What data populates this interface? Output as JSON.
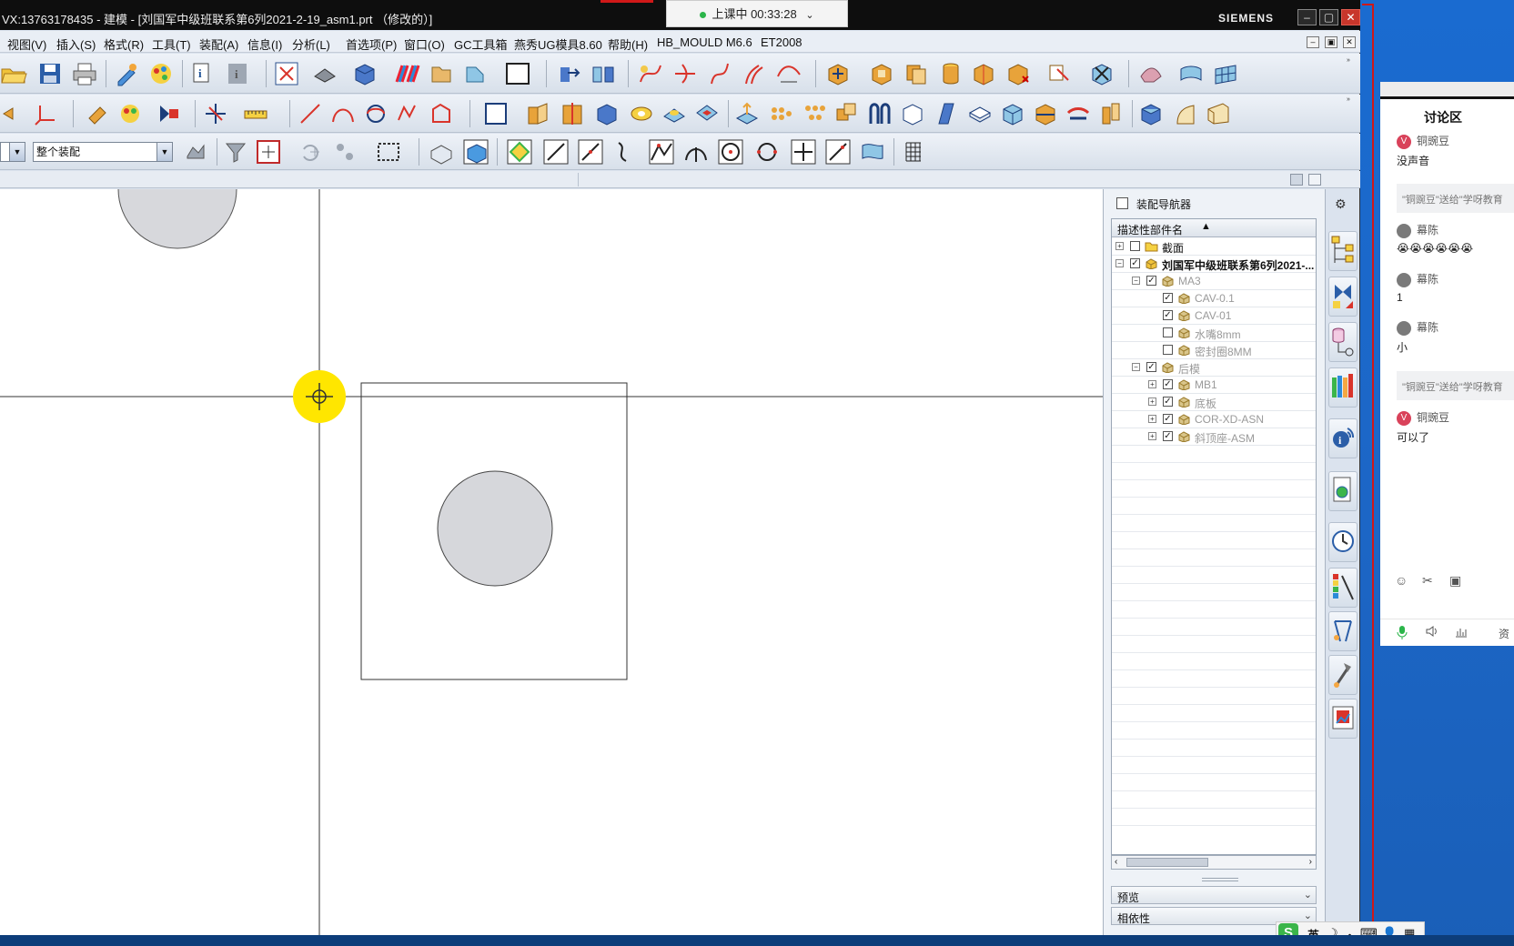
{
  "window": {
    "title": "VX:13763178435 - 建模 - [刘国军中级班联系第6列2021-2-19_asm1.prt （修改的）]",
    "brand": "SIEMENS",
    "controls": [
      "–",
      "▢",
      "✕"
    ]
  },
  "class_status": {
    "label": "上课中 00:33:28",
    "chevron": "⌄"
  },
  "menu": {
    "items": [
      "视图(V)",
      "插入(S)",
      "格式(R)",
      "工具(T)",
      "装配(A)",
      "信息(I)",
      "分析(L)",
      "首选项(P)",
      "窗口(O)",
      "GC工具箱",
      "燕秀UG模具8.60",
      "帮助(H)",
      "HB_MOULD M6.6",
      "ET2008"
    ],
    "mdi_controls": [
      "–",
      "▣",
      "✕"
    ]
  },
  "selection_bar": {
    "filter_value": "整个装配"
  },
  "assembly_navigator": {
    "title": "装配导航器",
    "column_header": "描述性部件名",
    "sort_indicator": "▲",
    "nodes": [
      {
        "label": "截面",
        "expander": "+",
        "checked": false,
        "dim": false
      },
      {
        "label": "刘国军中级班联系第6列2021-...",
        "expander": "−",
        "checked": true,
        "dim": false
      },
      {
        "label": "MA3",
        "expander": "−",
        "checked": true,
        "dim": true
      },
      {
        "label": "CAV-0.1",
        "expander": "",
        "checked": true,
        "dim": true
      },
      {
        "label": "CAV-01",
        "expander": "",
        "checked": true,
        "dim": true
      },
      {
        "label": "水嘴8mm",
        "expander": "",
        "checked": false,
        "dim": true
      },
      {
        "label": "密封圈8MM",
        "expander": "",
        "checked": false,
        "dim": true
      },
      {
        "label": "后模",
        "expander": "−",
        "checked": true,
        "dim": true
      },
      {
        "label": "MB1",
        "expander": "+",
        "checked": true,
        "dim": true
      },
      {
        "label": "底板",
        "expander": "+",
        "checked": true,
        "dim": true
      },
      {
        "label": "COR-XD-ASN",
        "expander": "+",
        "checked": true,
        "dim": true
      },
      {
        "label": "斜顶座-ASM",
        "expander": "+",
        "checked": true,
        "dim": true
      }
    ],
    "sections": [
      "预览",
      "相依性"
    ]
  },
  "chat": {
    "tab": "讨论区",
    "messages": [
      {
        "type": "user",
        "name": "铜豌豆",
        "avatar": "V",
        "color": "#d9425a"
      },
      {
        "type": "text",
        "text": "没声音"
      },
      {
        "type": "gift",
        "text": "\"铜豌豆\"送给\"学呀教育"
      },
      {
        "type": "user",
        "name": "幕陈",
        "avatar": "",
        "color": "#7a7a7a"
      },
      {
        "type": "text",
        "text": "😭😭😭😭😭😭"
      },
      {
        "type": "user",
        "name": "幕陈",
        "avatar": "",
        "color": "#7a7a7a"
      },
      {
        "type": "text",
        "text": "1"
      },
      {
        "type": "user",
        "name": "幕陈",
        "avatar": "",
        "color": "#7a7a7a"
      },
      {
        "type": "text",
        "text": "小"
      },
      {
        "type": "gift",
        "text": "\"铜豌豆\"送给\"学呀教育"
      },
      {
        "type": "user",
        "name": "铜豌豆",
        "avatar": "V",
        "color": "#d9425a"
      },
      {
        "type": "text",
        "text": "可以了"
      }
    ],
    "tools": [
      "☺",
      "✂",
      "▣"
    ],
    "bottom": [
      "mic-icon",
      "speaker-icon",
      "chart-icon",
      "资"
    ]
  },
  "ime": {
    "logo": "S",
    "lang": "英",
    "icons": [
      "☽",
      "・",
      "⌨",
      "👤",
      "▦"
    ]
  },
  "colors": {
    "titlebar": "#0e0e0e",
    "close": "#c8362b",
    "accent": "#ffe600",
    "desktop": "#1a6bd0"
  }
}
